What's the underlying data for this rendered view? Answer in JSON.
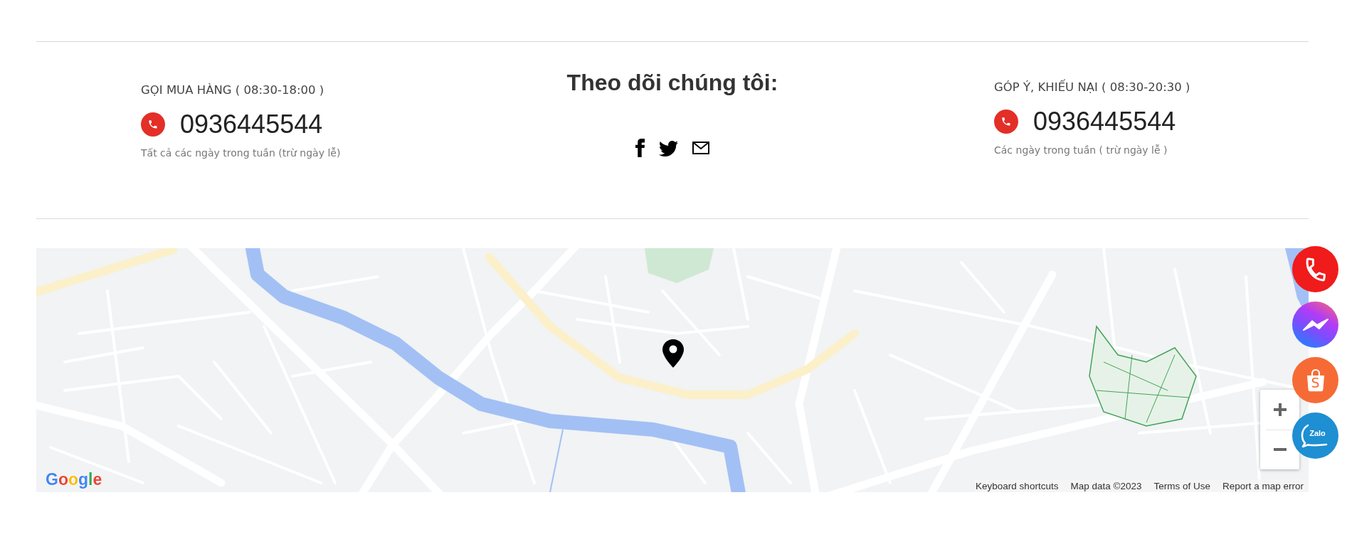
{
  "contacts": [
    {
      "label": "GỌI MUA HÀNG ( 08:30-18:00 )",
      "phone": "0936445544",
      "note": "Tất cả các ngày trong tuần (trừ ngày lễ)"
    },
    {
      "label": "GÓP Ý, KHIẾU NẠI ( 08:30-20:30 )",
      "phone": "0936445544",
      "note": "Các ngày trong tuần ( trừ ngày lễ )"
    }
  ],
  "follow": {
    "title": "Theo dõi chúng tôi:",
    "links": [
      {
        "kind": "facebook"
      },
      {
        "kind": "twitter"
      },
      {
        "kind": "email"
      }
    ]
  },
  "map": {
    "logo": "Google",
    "attribution": [
      "Keyboard shortcuts",
      "Map data ©2023",
      "Terms of Use",
      "Report a map error"
    ]
  },
  "floating_buttons": [
    {
      "kind": "phone"
    },
    {
      "kind": "messenger"
    },
    {
      "kind": "shop",
      "label": "S"
    },
    {
      "kind": "zalo",
      "label": "Zalo"
    }
  ]
}
